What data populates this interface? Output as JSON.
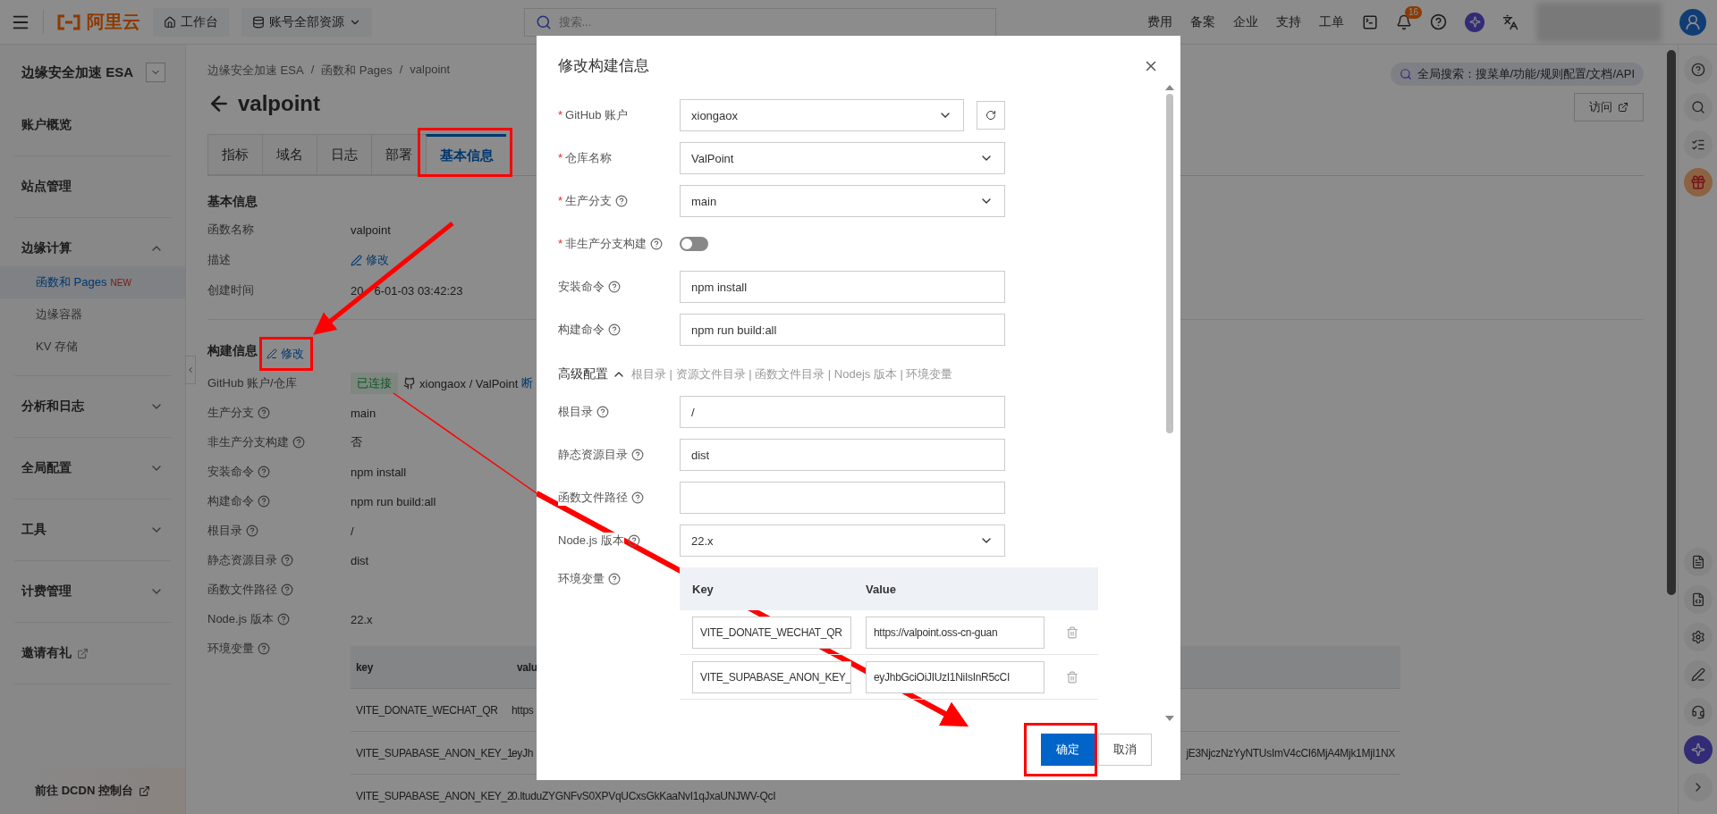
{
  "top_bar": {
    "logo": "阿里云",
    "workbench": "工作台",
    "resources": "账号全部资源",
    "search": {
      "placeholder": "搜索..."
    },
    "nav": [
      "费用",
      "备案",
      "企业",
      "支持",
      "工单"
    ],
    "notification_count": "16"
  },
  "sidebar": {
    "title": "边缘安全加速 ESA",
    "items": [
      {
        "label": "账户概览",
        "kind": "link"
      },
      {
        "label": "站点管理",
        "kind": "link"
      },
      {
        "label": "边缘计算",
        "kind": "group",
        "expanded": true,
        "children": [
          {
            "label": "函数和 Pages",
            "badge": "NEW",
            "selected": true
          },
          {
            "label": "边缘容器",
            "selected": false
          },
          {
            "label": "KV 存储",
            "selected": false
          }
        ]
      },
      {
        "label": "分析和日志",
        "kind": "group",
        "expanded": false
      },
      {
        "label": "全局配置",
        "kind": "group",
        "expanded": false
      },
      {
        "label": "工具",
        "kind": "group",
        "expanded": false
      },
      {
        "label": "计费管理",
        "kind": "group",
        "expanded": false
      },
      {
        "label": "邀请有礼",
        "kind": "external"
      }
    ],
    "footer_link": "前往 DCDN 控制台"
  },
  "breadcrumb": {
    "items": [
      "边缘安全加速 ESA",
      "函数和 Pages",
      "valpoint"
    ],
    "separator": "/"
  },
  "title": "valpoint",
  "global_search": "全局搜索：搜菜单/功能/规则配置/文档/API",
  "visit_button": "访问",
  "tabs": [
    {
      "label": "指标",
      "selected": false
    },
    {
      "label": "域名",
      "selected": false
    },
    {
      "label": "日志",
      "selected": false
    },
    {
      "label": "部署",
      "selected": false
    },
    {
      "label": "基本信息",
      "selected": true
    }
  ],
  "basic_info": {
    "heading": "基本信息",
    "rows": [
      {
        "label": "函数名称",
        "kind": "text",
        "value": "valpoint"
      },
      {
        "label": "描述",
        "kind": "link",
        "value": "修改"
      },
      {
        "label": "创建时间",
        "kind": "split",
        "parts": [
          "20",
          "6-01-03 03:42:23"
        ]
      }
    ]
  },
  "build_info": {
    "heading": "构建信息",
    "edit_link": "修改",
    "rows": [
      {
        "label": "GitHub 账户/仓库",
        "kind": "repo",
        "status": "已连接",
        "value": "xiongaox / ValPoint",
        "action": "断"
      },
      {
        "label": "生产分支",
        "kind": "text",
        "help": true,
        "value": "main"
      },
      {
        "label": "非生产分支构建",
        "kind": "text",
        "help": true,
        "value": "否"
      },
      {
        "label": "安装命令",
        "kind": "text",
        "help": true,
        "value": "npm install"
      },
      {
        "label": "构建命令",
        "kind": "text",
        "help": true,
        "value": "npm run build:all"
      },
      {
        "label": "根目录",
        "kind": "text",
        "help": true,
        "value": "/"
      },
      {
        "label": "静态资源目录",
        "kind": "text",
        "help": true,
        "value": "dist"
      },
      {
        "label": "函数文件路径",
        "kind": "text",
        "help": true
      },
      {
        "label": "Node.js 版本",
        "kind": "text",
        "help": true,
        "value": "22.x"
      },
      {
        "label": "环境变量",
        "kind": "table",
        "help": true
      }
    ],
    "env_table": {
      "columns": [
        "key",
        "valu"
      ],
      "rows": [
        {
          "key": "VITE_DONATE_WECHAT_QR",
          "value_start": "https"
        },
        {
          "key": "VITE_SUPABASE_ANON_KEY_1",
          "value_start": "eyJh",
          "value_end": "jE3NjczNzYyNTUsImV4cCI6MjA4Mjk1MjI1NX"
        },
        {
          "key": "VITE_SUPABASE_ANON_KEY_2",
          "value_start": "0.ltuduZYGNFvS0XPVqUCxsGkKaaNvI1qJxaUNJWV-QcI"
        }
      ]
    }
  },
  "modal": {
    "title": "修改构建信息",
    "fields": [
      {
        "label": "GitHub 账户",
        "required_mark": "*",
        "kind": "select",
        "value": "xiongaox",
        "refresh": true
      },
      {
        "label": "仓库名称",
        "required_mark": "*",
        "kind": "select",
        "value": "ValPoint"
      },
      {
        "label": "生产分支",
        "required_mark": "*",
        "help": true,
        "kind": "select",
        "value": "main"
      },
      {
        "label": "非生产分支构建",
        "required_mark": "*",
        "help": true,
        "kind": "switch",
        "on": false
      },
      {
        "label": "安装命令",
        "help": true,
        "kind": "input",
        "value": "npm install"
      },
      {
        "label": "构建命令",
        "help": true,
        "kind": "input",
        "value": "npm run build:all"
      },
      {
        "label": "高级配置",
        "kind": "section",
        "expanded": true,
        "summary": "根目录 | 资源文件目录 | 函数文件目录 | Nodejs 版本 | 环境变量"
      },
      {
        "label": "根目录",
        "help": true,
        "kind": "input",
        "value": "/"
      },
      {
        "label": "静态资源目录",
        "help": true,
        "kind": "input",
        "value": "dist"
      },
      {
        "label": "函数文件路径",
        "help": true,
        "kind": "input"
      },
      {
        "label": "Node.js 版本",
        "help": true,
        "kind": "select",
        "value": "22.x"
      },
      {
        "label": "环境变量",
        "help": true,
        "kind": "env"
      }
    ],
    "env_columns": [
      "Key",
      "Value"
    ],
    "env_rows": [
      {
        "key": "VITE_DONATE_WECHAT_QR",
        "value": "https://valpoint.oss-cn-guan"
      },
      {
        "key": "VITE_SUPABASE_ANON_KEY_",
        "value": "eyJhbGciOiJIUzI1NiIsInR5cCI"
      }
    ],
    "buttons": [
      {
        "label": "确定",
        "kind": "primary"
      },
      {
        "label": "取消",
        "kind": "secondary"
      }
    ]
  }
}
